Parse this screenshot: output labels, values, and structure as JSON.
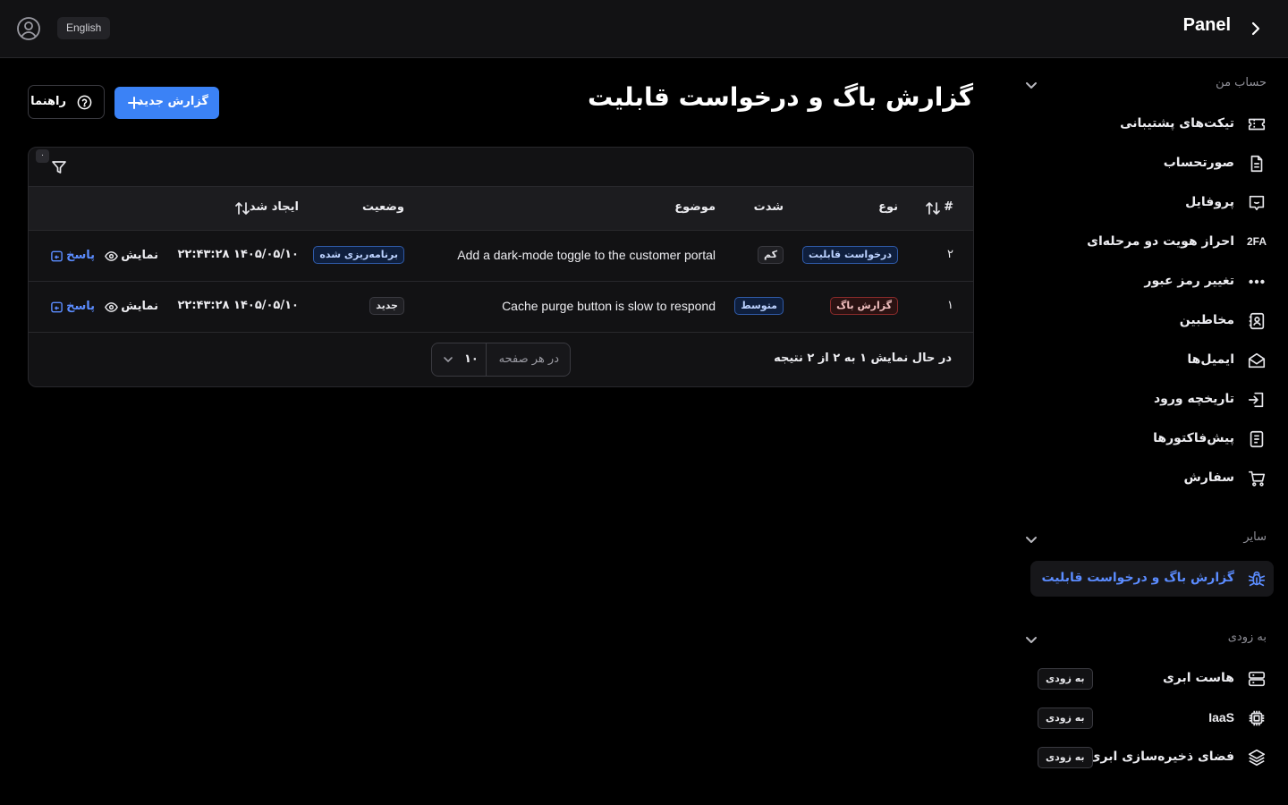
{
  "header": {
    "brand": "Panel",
    "language_button": "English"
  },
  "sidebar": {
    "sections": [
      {
        "title": "حساب من",
        "items": [
          {
            "label": "تیکت‌های پشتیبانی",
            "icon": "ticket-icon"
          },
          {
            "label": "صورتحساب",
            "icon": "invoice-icon"
          },
          {
            "label": "پروفایل",
            "icon": "profile-icon"
          },
          {
            "label": "احراز هویت دو مرحله‌ای",
            "icon": "2fa-icon",
            "icon_text": "2FA"
          },
          {
            "label": "تغییر رمز عبور",
            "icon": "password-dots-icon"
          },
          {
            "label": "مخاطبین",
            "icon": "contacts-icon"
          },
          {
            "label": "ایمیل‌ها",
            "icon": "mail-icon"
          },
          {
            "label": "تاریخچه ورود",
            "icon": "login-history-icon"
          },
          {
            "label": "پیش‌فاکتورها",
            "icon": "proforma-icon"
          },
          {
            "label": "سفارش",
            "icon": "cart-icon"
          }
        ]
      },
      {
        "title": "سایر",
        "items": [
          {
            "label": "گزارش باگ و درخواست قابلیت",
            "icon": "bug-icon",
            "active": true
          }
        ]
      },
      {
        "title": "به زودی",
        "items": [
          {
            "label": "هاست ابری",
            "icon": "server-icon",
            "badge": "به زودی"
          },
          {
            "label": "IaaS",
            "icon": "chip-icon",
            "badge": "به زودی"
          },
          {
            "label": "فضای ذخیره‌سازی ابری",
            "icon": "layers-icon",
            "badge": "به زودی"
          }
        ]
      }
    ]
  },
  "main": {
    "title": "گزارش باگ و درخواست قابلیت",
    "new_report_button": "گزارش جدید",
    "guide_button": "راهنما",
    "filter_count": "۰",
    "columns": {
      "id": "#",
      "type": "نوع",
      "severity": "شدت",
      "subject": "موضوع",
      "status": "وضعیت",
      "created": "ایجاد شد"
    },
    "rows": [
      {
        "id": "۲",
        "type": "درخواست قابلیت",
        "type_kind": "feature",
        "severity": "کم",
        "severity_kind": "low",
        "subject": "Add a dark-mode toggle to the customer portal",
        "status": "برنامه‌ریزی شده",
        "status_kind": "sched",
        "created": "۱۴۰۵/۰۵/۱۰ ۲۲:۴۳:۲۸",
        "view": "نمایش",
        "reply": "پاسخ"
      },
      {
        "id": "۱",
        "type": "گزارش باگ",
        "type_kind": "bug",
        "severity": "متوسط",
        "severity_kind": "med",
        "subject": "Cache purge button is slow to respond",
        "status": "جدید",
        "status_kind": "new",
        "created": "۱۴۰۵/۰۵/۱۰ ۲۲:۴۳:۲۸",
        "view": "نمایش",
        "reply": "پاسخ"
      }
    ],
    "footer": {
      "summary": "در حال نمایش ۱ به ۲ از ۲ نتیجه",
      "per_page_label": "در هر صفحه",
      "per_page_value": "۱۰"
    }
  },
  "colors": {
    "accent": "#3b82f6",
    "link": "#5b8cff",
    "background": "#000000",
    "surface": "#121214"
  }
}
